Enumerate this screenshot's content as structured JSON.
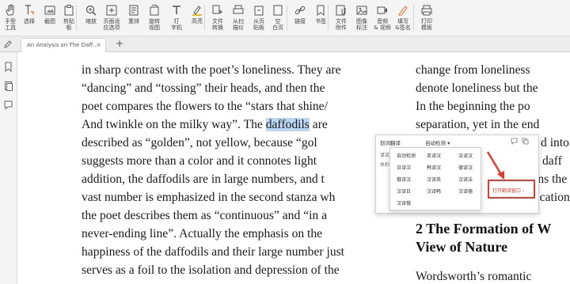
{
  "toolbar": {
    "items": [
      {
        "label": "手型\n工具",
        "icon": "hand-icon"
      },
      {
        "label": "选择",
        "icon": "text-select-icon"
      },
      {
        "label": "截图",
        "icon": "screenshot-icon"
      },
      {
        "label": "剪贴\n板",
        "icon": "clipboard-icon"
      },
      {
        "label": "缩放",
        "icon": "zoom-icon"
      },
      {
        "label": "页面适\n应选项",
        "icon": "fit-page-icon"
      },
      {
        "label": "重排",
        "icon": "reflow-icon"
      },
      {
        "label": "旋转\n视图",
        "icon": "rotate-view-icon"
      },
      {
        "label": "打\n字机",
        "icon": "typewriter-icon"
      },
      {
        "label": "高亮",
        "icon": "highlight-icon"
      },
      {
        "label": "文件\n转换",
        "icon": "file-convert-icon"
      },
      {
        "label": "从扫\n描仪",
        "icon": "scanner-icon"
      },
      {
        "label": "从页\n贴板",
        "icon": "from-clipboard-icon"
      },
      {
        "label": "空\n白页",
        "icon": "blank-page-icon"
      },
      {
        "label": "链接",
        "icon": "link-icon"
      },
      {
        "label": "书签",
        "icon": "bookmark-icon"
      },
      {
        "label": "文件\n附件",
        "icon": "attachment-icon"
      },
      {
        "label": "图像\n标注",
        "icon": "image-annotation-icon"
      },
      {
        "label": "音频\n& 视频",
        "icon": "audio-video-icon"
      },
      {
        "label": "填写\n&签名",
        "icon": "fill-sign-icon"
      },
      {
        "label": "打印\n模板",
        "icon": "print-template-icon"
      }
    ]
  },
  "tabs": {
    "active_title": "An Analysis on The Daff...",
    "close": "×",
    "new_tab": "+"
  },
  "document": {
    "left_lines": [
      "in sharp contrast with the poet’s loneliness. They are",
      "“dancing” and “tossing” their heads, and then the",
      "poet compares the flowers to the “stars that shine/",
      "And twinkle on the milky way”. The ",
      "described as “golden”, not yellow, because “gol",
      "suggests more than a color and it connotes light",
      "addition, the daffodils are in large numbers, and t",
      "vast number is emphasized in the second stanza wh",
      "the poet describes them as “continuous” and “in a",
      "never-ending line”. Actually the emphasis on the",
      "happiness of the daffodils and their large number just",
      "serves as a foil to the isolation and depression of the"
    ],
    "highlight_word": "daffodils",
    "after_highlight": " are",
    "right_lines": [
      "change from loneliness",
      "denote loneliness but the",
      "In the beginning the po",
      "separation, yet in the end"
    ],
    "right_fragments": [
      "d into",
      "daff",
      "ins the",
      "in purification in"
    ],
    "heading_line1": "2  The Formation of W",
    "heading_line2": "View of Nature",
    "bottom_right": "Wordsworth’s romantic"
  },
  "popup": {
    "title": "划词翻译",
    "mode": "自动检测",
    "left_labels": [
      "译文",
      "水杉"
    ],
    "dropdown_items": [
      [
        "自动检测",
        "英译汉",
        "法译汉"
      ],
      [
        "日译汉",
        "韩译汉",
        "德译汉"
      ],
      [
        "俄译汉",
        "汉译英",
        "汉译法"
      ],
      [
        "汉译日",
        "汉译韩",
        "汉译德"
      ],
      [
        "汉译俄",
        "",
        ""
      ]
    ],
    "open_window": "打开翻译窗口"
  },
  "colors": {
    "highlight": "#bcd7f3",
    "accent_red": "#e33b2e"
  }
}
